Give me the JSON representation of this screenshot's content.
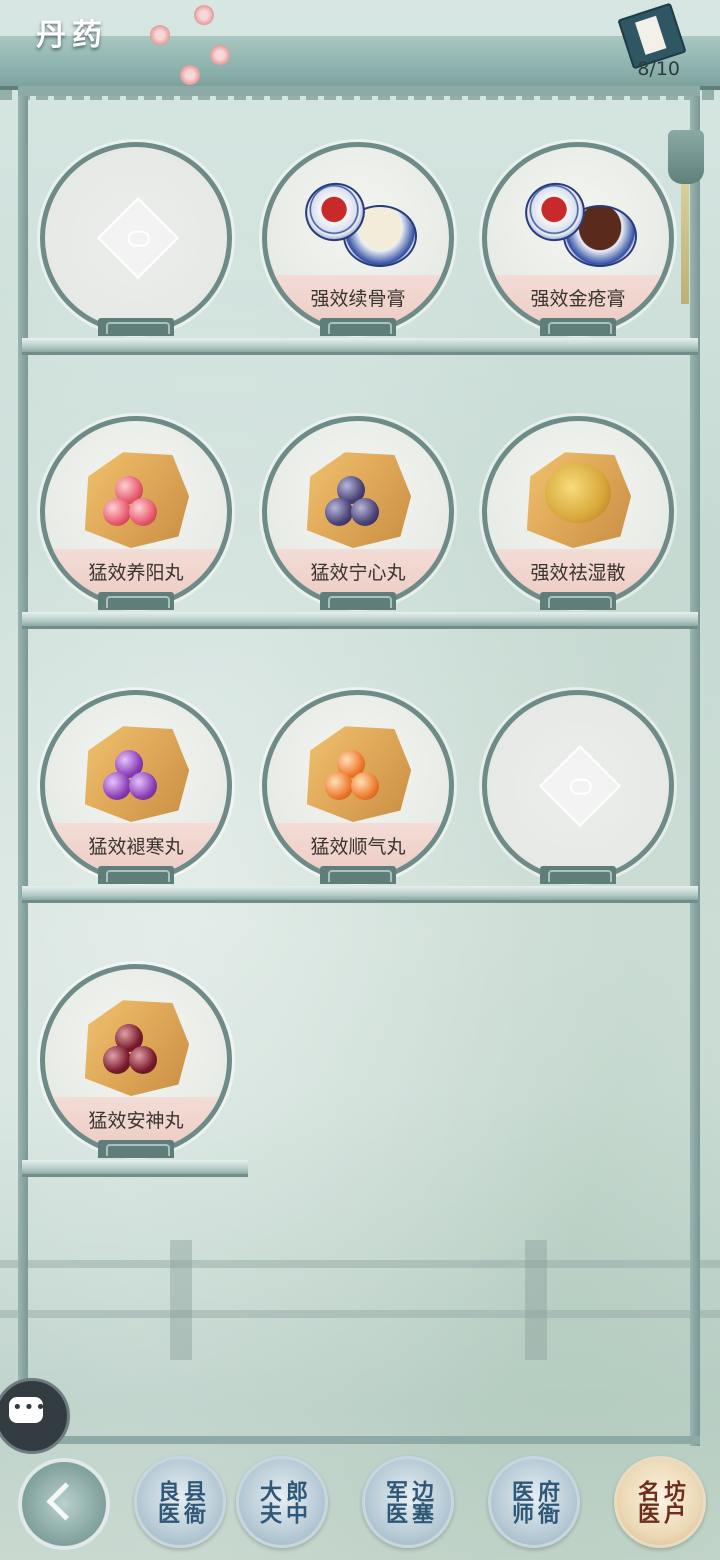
{
  "header": {
    "title": "丹药",
    "count": "8/10"
  },
  "items": [
    {
      "label": "",
      "locked": true,
      "type": "empty"
    },
    {
      "label": "强效续骨膏",
      "locked": false,
      "type": "jar",
      "paste": "#f2ecd9"
    },
    {
      "label": "强效金疮膏",
      "locked": false,
      "type": "jar",
      "paste": "#5a2a1c"
    },
    {
      "label": "猛效养阳丸",
      "locked": false,
      "type": "pills",
      "pill": "pink"
    },
    {
      "label": "猛效宁心丸",
      "locked": false,
      "type": "pills",
      "pill": "navy"
    },
    {
      "label": "强效祛湿散",
      "locked": false,
      "type": "powder"
    },
    {
      "label": "猛效褪寒丸",
      "locked": false,
      "type": "pills",
      "pill": "purple"
    },
    {
      "label": "猛效顺气丸",
      "locked": false,
      "type": "pills",
      "pill": "orange"
    },
    {
      "label": "",
      "locked": true,
      "type": "empty"
    },
    {
      "label": "猛效安神丸",
      "locked": false,
      "type": "pills",
      "pill": "wine"
    }
  ],
  "nav": {
    "tabs": [
      {
        "label": "县衙 良医",
        "active": false
      },
      {
        "label": "郎中 大夫",
        "active": false
      },
      {
        "label": "边塞 军医",
        "active": false
      },
      {
        "label": "府衙 医师",
        "active": false
      },
      {
        "label": "坊户 名医",
        "active": true
      }
    ]
  }
}
